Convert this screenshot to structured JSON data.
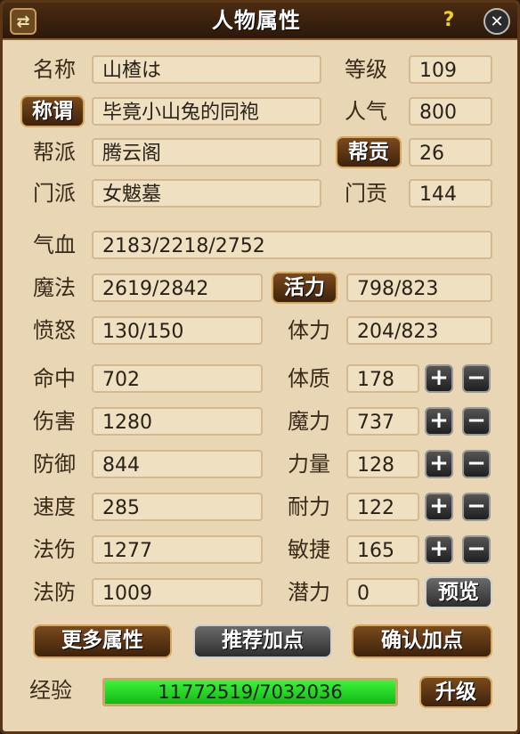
{
  "title": "人物属性",
  "icons": {
    "menu": "transfer-arrows-icon",
    "help": "question-mark-icon",
    "close": "close-x-icon"
  },
  "glyphs": {
    "menu": "⇄",
    "help": "?",
    "close": "✕"
  },
  "identity": {
    "name_label": "名称",
    "name_value": "山楂は",
    "title_button": "称谓",
    "title_value": "毕竟小山兔的同袍",
    "gang_label": "帮派",
    "gang_value": "腾云阁",
    "sect_label": "门派",
    "sect_value": "女魃墓",
    "level_label": "等级",
    "level_value": "109",
    "popularity_label": "人气",
    "popularity_value": "800",
    "gang_contrib_button": "帮贡",
    "gang_contrib_value": "26",
    "sect_contrib_label": "门贡",
    "sect_contrib_value": "144"
  },
  "vitals": {
    "hp_label": "气血",
    "hp_value": "2183/2218/2752",
    "mp_label": "魔法",
    "mp_value": "2619/2842",
    "vitality_button": "活力",
    "vitality_value": "798/823",
    "rage_label": "愤怒",
    "rage_value": "130/150",
    "stamina_label": "体力",
    "stamina_value": "204/823"
  },
  "combat": [
    {
      "label": "命中",
      "value": "702"
    },
    {
      "label": "伤害",
      "value": "1280"
    },
    {
      "label": "防御",
      "value": "844"
    },
    {
      "label": "速度",
      "value": "285"
    },
    {
      "label": "法伤",
      "value": "1277"
    },
    {
      "label": "法防",
      "value": "1009"
    }
  ],
  "attributes": [
    {
      "label": "体质",
      "value": "178"
    },
    {
      "label": "魔力",
      "value": "737"
    },
    {
      "label": "力量",
      "value": "128"
    },
    {
      "label": "耐力",
      "value": "122"
    },
    {
      "label": "敏捷",
      "value": "165"
    }
  ],
  "plus_sign": "+",
  "minus_sign": "−",
  "potential": {
    "label": "潜力",
    "value": "0",
    "preview_button": "预览"
  },
  "buttons": {
    "more": "更多属性",
    "recommend": "推荐加点",
    "confirm": "确认加点"
  },
  "experience": {
    "label": "经验",
    "value": "11772519/7032036",
    "fill_fraction": 1.0,
    "upgrade_button": "升级"
  },
  "colors": {
    "panel_bg": "#e8d6b4",
    "title_bar": "#3a2210",
    "exp_bar": "#22d422",
    "brown_button": "#5c3414",
    "gray_button": "#4a4a4a"
  }
}
